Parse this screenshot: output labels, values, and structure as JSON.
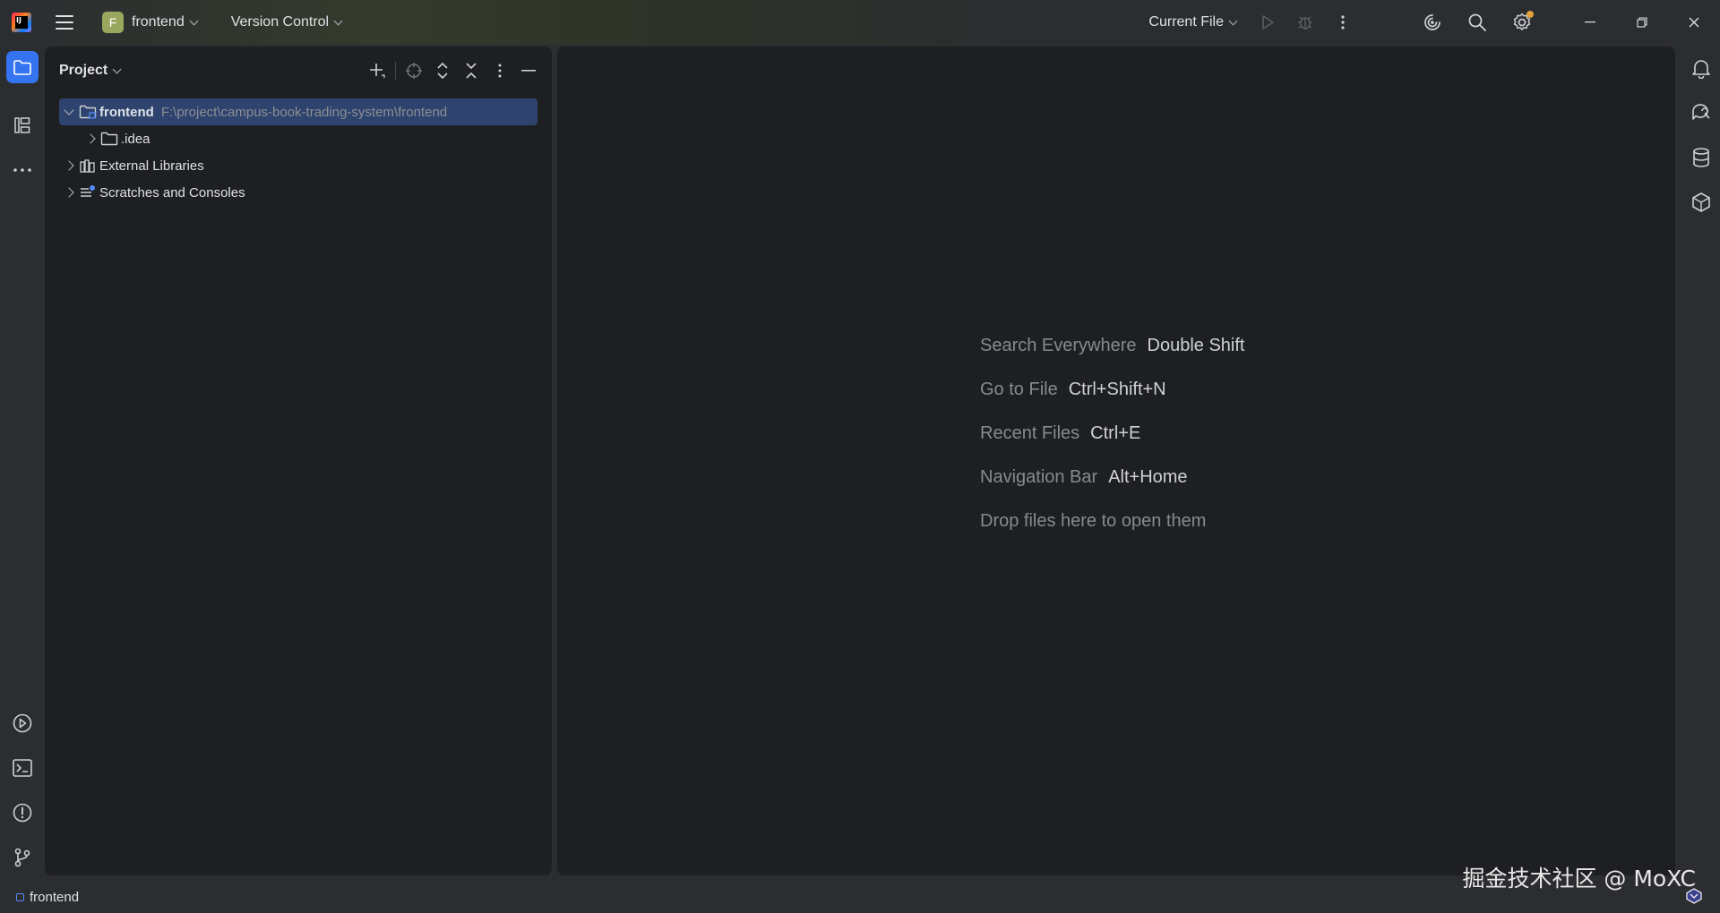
{
  "titlebar": {
    "project_badge": "F",
    "project_name": "frontend",
    "vcs_label": "Version Control",
    "run_config": "Current File"
  },
  "project_panel": {
    "title": "Project",
    "tree": {
      "root": {
        "name": "frontend",
        "path": "F:\\project\\campus-book-trading-system\\frontend"
      },
      "idea": ".idea",
      "external_libraries": "External Libraries",
      "scratches": "Scratches and Consoles"
    }
  },
  "editor": {
    "hints": [
      {
        "label": "Search Everywhere",
        "key": "Double Shift"
      },
      {
        "label": "Go to File",
        "key": "Ctrl+Shift+N"
      },
      {
        "label": "Recent Files",
        "key": "Ctrl+E"
      },
      {
        "label": "Navigation Bar",
        "key": "Alt+Home"
      }
    ],
    "drop_hint": "Drop files here to open them"
  },
  "statusbar": {
    "breadcrumb": "frontend"
  },
  "watermark": "掘金技术社区 @ MoXC",
  "colors": {
    "accent": "#3574f0",
    "selection": "#2e436e",
    "panel_bg": "#1e1f22",
    "chrome_bg": "#2b2d30"
  }
}
